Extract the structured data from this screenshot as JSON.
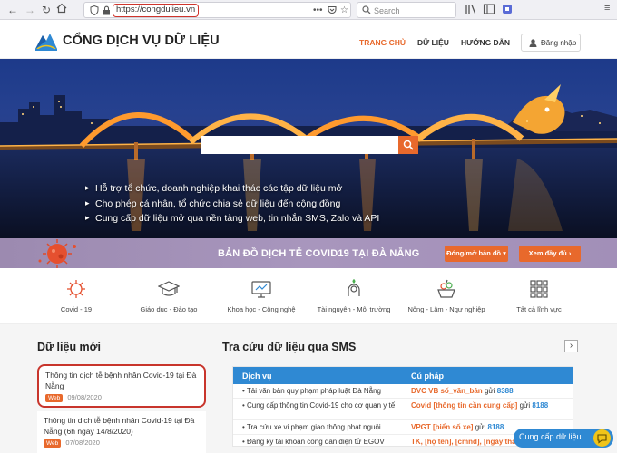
{
  "browser": {
    "url": "https://congdulieu.vn",
    "search_placeholder": "Search"
  },
  "header": {
    "site_title": "CỔNG DỊCH VỤ DỮ LIỆU",
    "nav": [
      "TRANG CHỦ",
      "DỮ LIỆU",
      "HƯỚNG DẪN"
    ],
    "login": "Đăng nhập"
  },
  "hero": {
    "search_placeholder": "",
    "bullets": [
      "Hỗ trợ tổ chức, doanh nghiệp khai thác các tập dữ liệu mở",
      "Cho phép cá nhân, tổ chức chia sẻ dữ liệu đến cộng đồng",
      "Cung cấp dữ liệu mở qua nền tảng web, tin nhắn SMS, Zalo và API"
    ]
  },
  "covid": {
    "title": "BẢN ĐỒ DỊCH TỄ COVID19 TẠI ĐÀ NẴNG",
    "toggle_map": "Đóng/mở bản đồ ▾",
    "view_full": "Xem đầy đủ ›"
  },
  "categories": [
    {
      "label": "Covid - 19",
      "icon": "virus-icon"
    },
    {
      "label": "Giáo dục - Đào tạo",
      "icon": "graduation-cap-icon"
    },
    {
      "label": "Khoa học - Công nghệ",
      "icon": "monitor-icon"
    },
    {
      "label": "Tài nguyên - Môi trường",
      "icon": "leaf-head-icon"
    },
    {
      "label": "Nông - Lâm - Ngư nghiệp",
      "icon": "fruit-basket-icon"
    },
    {
      "label": "Tất cả lĩnh vực",
      "icon": "grid-icon"
    }
  ],
  "new_data": {
    "title": "Dữ liệu mới",
    "items": [
      {
        "title": "Thông tin dịch tễ bệnh nhân Covid-19 tại Đà Nẵng",
        "badge": "Web",
        "date": "09/08/2020"
      },
      {
        "title": "Thông tin dịch tễ bệnh nhân Covid-19 tại Đà Nẵng (6h ngày 14/8/2020)",
        "badge": "Web",
        "date": "07/08/2020"
      }
    ]
  },
  "sms": {
    "title": "Tra cứu dữ liệu qua SMS",
    "col_service": "Dịch vụ",
    "col_syntax": "Cú pháp",
    "rows": [
      {
        "service": "Tải văn bản quy phạm pháp luật Đà Nẵng",
        "syntax": "DVC VB số_văn_bản",
        "send": "gửi",
        "number": "8388"
      },
      {
        "service": "Cung cấp thông tin Covid-19 cho cơ quan y tế",
        "syntax": "Covid [thông tin cần cung cấp]",
        "send": "gửi",
        "number": "8188"
      },
      {
        "service": "Tra cứu xe vi phạm giao thông phạt nguội",
        "syntax": "VPGT [biển số xe]",
        "send": "gửi",
        "number": "8188"
      },
      {
        "service": "Đăng ký tài khoản công dân điện tử EGOV",
        "syntax": "TK, [họ tên], [cmnd], [ngày tháng năm sinh]",
        "send": "",
        "number": ""
      }
    ]
  },
  "provide_button": "Cung cấp dữ liệu",
  "colors": {
    "accent": "#e8692c",
    "blue": "#2f89d3",
    "highlight": "#c8352c"
  }
}
